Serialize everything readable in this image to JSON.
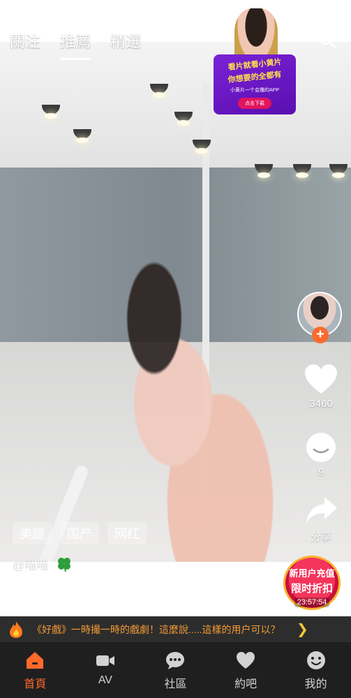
{
  "top_tabs": [
    {
      "label": "關注"
    },
    {
      "label": "推薦"
    },
    {
      "label": "精選"
    }
  ],
  "ad": {
    "line1": "看片就看小黄片",
    "line2": "你想要的全都有",
    "subtitle": "小黄片一个会撸的APP",
    "button": "点击下载"
  },
  "side_actions": {
    "likes": "3460",
    "comments": "9",
    "share": "分享"
  },
  "tags": [
    "美腿",
    "国产",
    "网红"
  ],
  "author": {
    "name": "@喵喵"
  },
  "promo": {
    "line1": "新用户充值",
    "line2": "限时折扣",
    "timer": "23:57:54"
  },
  "marquee": {
    "text": "《好戲》一時撮一時的戲劇！這麼說.....這樣的用户可以？"
  },
  "bottom_nav": [
    {
      "label": "首頁"
    },
    {
      "label": "AV"
    },
    {
      "label": "社區"
    },
    {
      "label": "約吧"
    },
    {
      "label": "我的"
    }
  ],
  "colors": {
    "accent": "#ff6a2c",
    "nav_bg": "#1f1f1f",
    "marquee_text": "#f39a34"
  }
}
